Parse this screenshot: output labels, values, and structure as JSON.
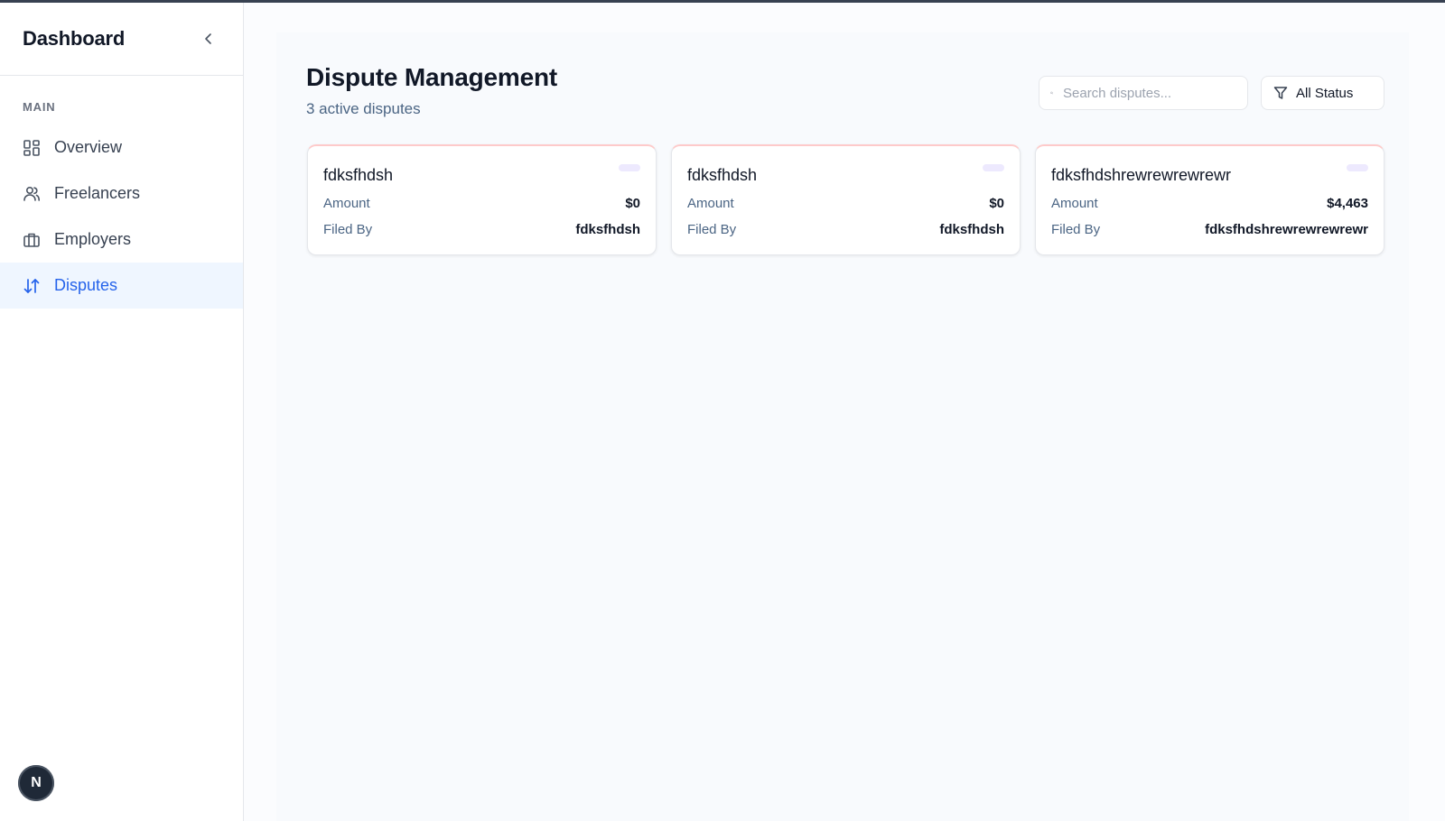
{
  "sidebar": {
    "title": "Dashboard",
    "section_label": "MAIN",
    "items": [
      {
        "label": "Overview",
        "icon": "grid-icon",
        "active": false
      },
      {
        "label": "Freelancers",
        "icon": "users-icon",
        "active": false
      },
      {
        "label": "Employers",
        "icon": "briefcase-icon",
        "active": false
      },
      {
        "label": "Disputes",
        "icon": "arrows-up-down-icon",
        "active": true
      }
    ],
    "avatar_letter": "N"
  },
  "header": {
    "title": "Dispute Management",
    "subtitle": "3 active disputes",
    "search_placeholder": "Search disputes...",
    "filter_label": "All Status"
  },
  "disputes": [
    {
      "title": "fdksfhdsh",
      "amount_label": "Amount",
      "amount": "$0",
      "filed_by_label": "Filed By",
      "filed_by": "fdksfhdsh"
    },
    {
      "title": "fdksfhdsh",
      "amount_label": "Amount",
      "amount": "$0",
      "filed_by_label": "Filed By",
      "filed_by": "fdksfhdsh"
    },
    {
      "title": "fdksfhdshrewrewrewrewr",
      "amount_label": "Amount",
      "amount": "$4,463",
      "filed_by_label": "Filed By",
      "filed_by": "fdksfhdshrewrewrewrewr"
    }
  ],
  "colors": {
    "accent": "#2563eb",
    "active_bg": "#eff6ff",
    "card_top_border": "#fecaca",
    "badge": "#ede9fe",
    "muted_text": "#4b6584"
  }
}
